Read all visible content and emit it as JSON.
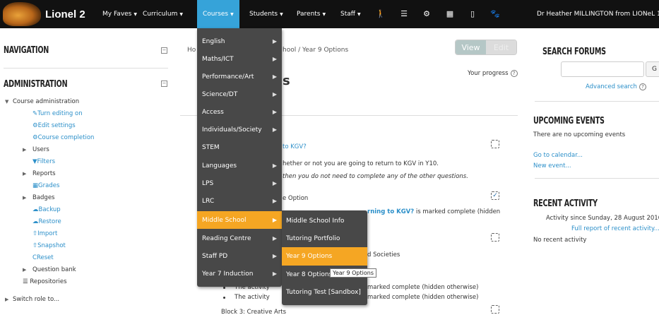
{
  "topbar": {
    "site_name": "Lionel 2",
    "nav": [
      "My Faves",
      "Curriculum",
      "Courses",
      "Students",
      "Parents",
      "Staff"
    ],
    "user": "Dr Heather MILLINGTON from LIONeL 1 ("
  },
  "left": {
    "navigation": "NAVIGATION",
    "administration": "ADMINISTRATION",
    "course_admin": "Course administration",
    "turn_editing": "Turn editing on",
    "edit_settings": "Edit settings",
    "course_completion": "Course completion",
    "users": "Users",
    "filters": "Filters",
    "reports": "Reports",
    "grades": "Grades",
    "badges": "Badges",
    "backup": "Backup",
    "restore": "Restore",
    "import": "Import",
    "snapshot": "Snapshot",
    "reset": "Reset",
    "question_bank": "Question bank",
    "repositories": "Repositories",
    "switch_role": "Switch role to..."
  },
  "main": {
    "crumb_ho": "Ho",
    "crumb_rest": "hool / Year 9 Options",
    "view": "View",
    "edit": "Edit",
    "progress": "Your progress",
    "title_frag": "s",
    "q1": "to KGV?",
    "q1_desc": "hether or not you are going to return to KGV in Y10.",
    "q1_desc2": "then you do not need to complete any of the other questions.",
    "opt": "e Option",
    "cond_link": "rning to KGV?",
    "cond_rest": " is marked complete (hidden",
    "b2": "d Societies",
    "act1": "The activity",
    "act1_rest": "marked complete (hidden otherwise)",
    "act2": "The activity",
    "act2_rest": "marked complete (hidden otherwise)",
    "b3": "Block 3: Creative Arts"
  },
  "right": {
    "search_title": "SEARCH FORUMS",
    "go": "G",
    "advanced": "Advanced search",
    "upcoming_title": "UPCOMING EVENTS",
    "no_events": "There are no upcoming events",
    "go_calendar": "Go to calendar...",
    "new_event": "New event...",
    "recent_title": "RECENT ACTIVITY",
    "since": "Activity since Sunday, 28 August 2016,",
    "full_report": "Full report of recent activity...",
    "no_recent": "No recent activity"
  },
  "courses_menu": [
    "English",
    "Maths/ICT",
    "Performance/Art",
    "Science/DT",
    "Access",
    "Individuals/Society",
    "STEM",
    "Languages",
    "LPS",
    "LRC",
    "Middle School",
    "Reading Centre",
    "Staff PD",
    "Year 7 Induction"
  ],
  "middle_menu": [
    "Middle School Info",
    "Tutoring Portfolio",
    "Year 9 Options",
    "Year 8 Options",
    "Tutoring Test [Sandbox]"
  ],
  "tooltip": "Year 9 Options"
}
